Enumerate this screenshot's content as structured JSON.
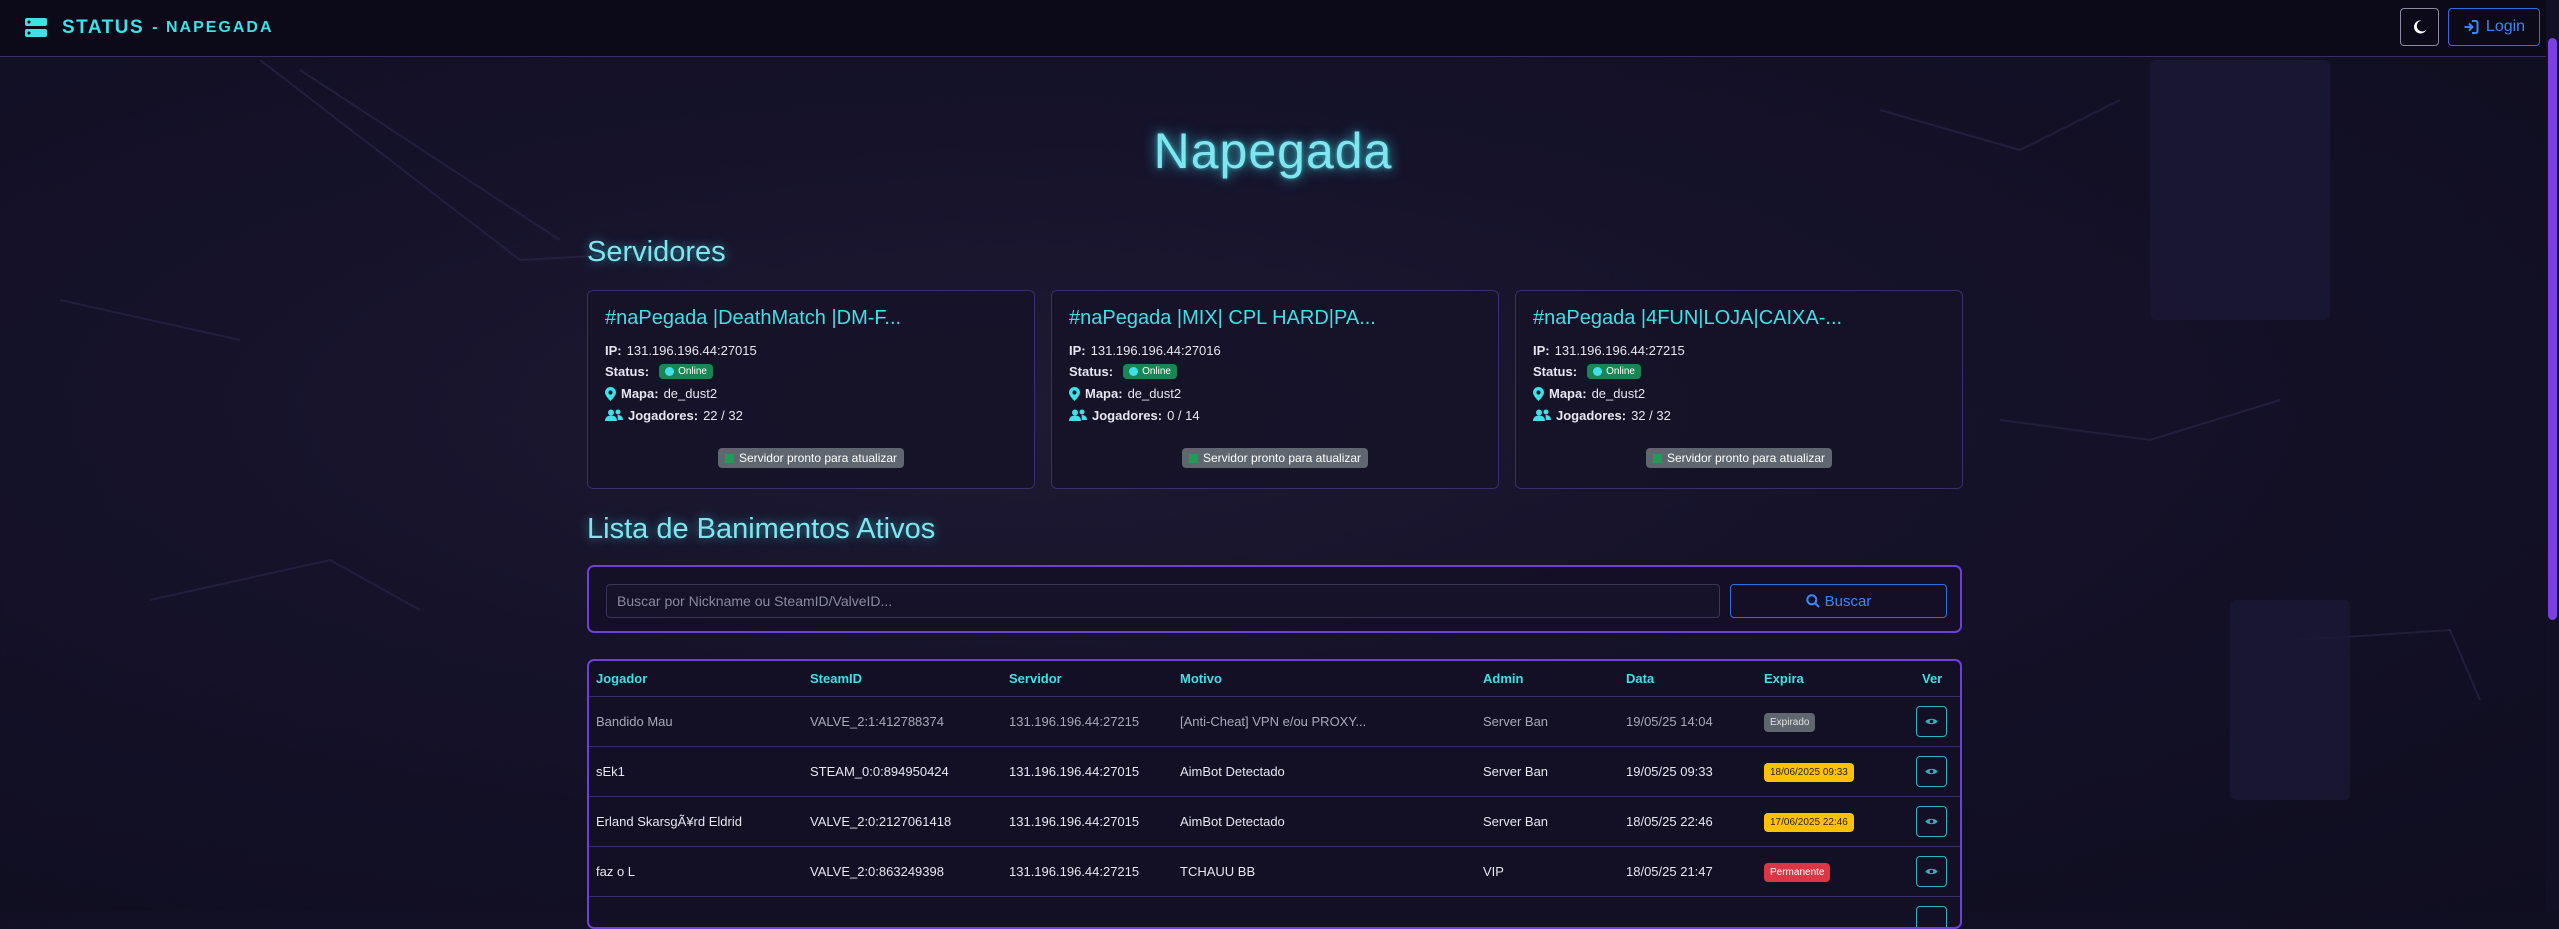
{
  "navbar": {
    "brand_title": "STATUS",
    "brand_subtitle": "- NAPEGADA",
    "login_label": "Login",
    "icons": {
      "brand": "server-icon",
      "theme": "moon-icon",
      "login": "sign-in-icon"
    }
  },
  "page_title": "Napegada",
  "servers_section": {
    "title": "Servidores",
    "ip_label": "IP:",
    "status_label": "Status:",
    "map_label": "Mapa:",
    "players_label": "Jogadores:",
    "cards": [
      {
        "name": "#naPegada |DeathMatch |DM-F...",
        "ip": "131.196.196.44:27015",
        "status": "Online",
        "map": "de_dust2",
        "players": "22 / 32",
        "update": "Servidor pronto para atualizar"
      },
      {
        "name": "#naPegada |MIX| CPL HARD|PA...",
        "ip": "131.196.196.44:27016",
        "status": "Online",
        "map": "de_dust2",
        "players": "0 / 14",
        "update": "Servidor pronto para atualizar"
      },
      {
        "name": "#naPegada |4FUN|LOJA|CAIXA-...",
        "ip": "131.196.196.44:27215",
        "status": "Online",
        "map": "de_dust2",
        "players": "32 / 32",
        "update": "Servidor pronto para atualizar"
      }
    ]
  },
  "bans_section": {
    "title": "Lista de Banimentos Ativos",
    "search_placeholder": "Buscar por Nickname ou SteamID/ValveID...",
    "search_button": "Buscar",
    "columns": [
      "Jogador",
      "SteamID",
      "Servidor",
      "Motivo",
      "Admin",
      "Data",
      "Expira",
      "Ver"
    ],
    "rows": [
      {
        "player": "Bandido Mau",
        "steamid": "VALVE_2:1:412788374",
        "server": "131.196.196.44:27215",
        "reason": "[Anti-Cheat] VPN e/ou PROXY...",
        "admin": "Server Ban",
        "date": "19/05/25 14:04",
        "expires": "Expirado",
        "expires_type": "expired"
      },
      {
        "player": "sEk1",
        "steamid": "STEAM_0:0:894950424",
        "server": "131.196.196.44:27015",
        "reason": "AimBot Detectado",
        "admin": "Server Ban",
        "date": "19/05/25 09:33",
        "expires": "18/06/2025 09:33",
        "expires_type": "warn"
      },
      {
        "player": "Erland SkarsgÃ¥rd Eldrid",
        "steamid": "VALVE_2:0:2127061418",
        "server": "131.196.196.44:27015",
        "reason": "AimBot Detectado",
        "admin": "Server Ban",
        "date": "18/05/25 22:46",
        "expires": "17/06/2025 22:46",
        "expires_type": "warn"
      },
      {
        "player": "faz o L",
        "steamid": "VALVE_2:0:863249398",
        "server": "131.196.196.44:27215",
        "reason": "TCHAUU BB",
        "admin": "VIP",
        "date": "18/05/25 21:47",
        "expires": "Permanente",
        "expires_type": "perm"
      }
    ]
  },
  "colors": {
    "accent": "#3fe0e8",
    "primary": "#3d85f5",
    "border": "#6f3fd8",
    "online": "#198754",
    "warn": "#ffc107",
    "danger": "#dc3545"
  }
}
